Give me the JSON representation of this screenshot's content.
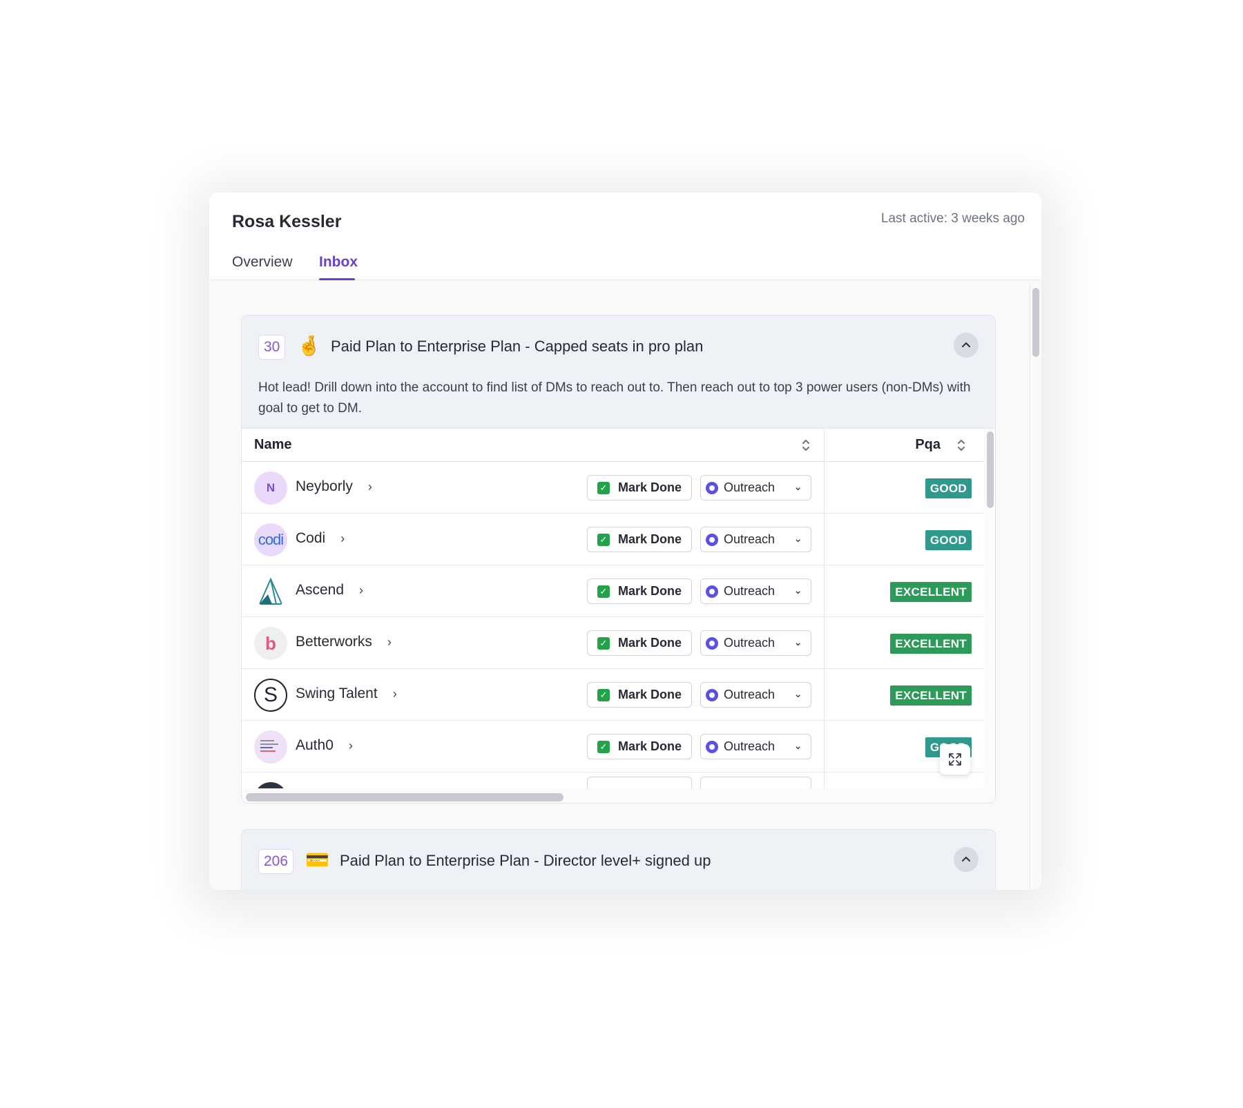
{
  "header": {
    "user_name": "Rosa Kessler",
    "last_active": "Last active: 3 weeks ago",
    "tabs": [
      {
        "label": "Overview",
        "active": false
      },
      {
        "label": "Inbox",
        "active": true
      }
    ]
  },
  "plays": [
    {
      "count": "30",
      "emoji": "🤞",
      "title": "Paid Plan to Enterprise Plan - Capped seats in pro plan",
      "description": "Hot lead! Drill down into the account to find list of DMs to reach out to. Then reach out to top 3 power users (non-DMs) with goal to get to DM.",
      "expanded": true,
      "table": {
        "columns": [
          "Name",
          "Pqa"
        ],
        "mark_done_label": "Mark Done",
        "outreach_label": "Outreach",
        "rows": [
          {
            "name": "Neyborly",
            "avatar": "N",
            "avatar_icon": "neyborly-logo",
            "pqa": "GOOD"
          },
          {
            "name": "Codi",
            "avatar": "codi",
            "avatar_icon": "codi-logo",
            "pqa": "GOOD"
          },
          {
            "name": "Ascend",
            "avatar": "",
            "avatar_icon": "ascend-logo",
            "pqa": "EXCELLENT"
          },
          {
            "name": "Betterworks",
            "avatar": "b",
            "avatar_icon": "betterworks-logo",
            "pqa": "EXCELLENT"
          },
          {
            "name": "Swing Talent",
            "avatar": "S",
            "avatar_icon": "swing-talent-logo",
            "pqa": "EXCELLENT"
          },
          {
            "name": "Auth0",
            "avatar": "",
            "avatar_icon": "auth0-logo",
            "pqa": "GOOD"
          }
        ]
      }
    },
    {
      "count": "206",
      "emoji": "💳",
      "title": "Paid Plan to Enterprise Plan - Director level+ signed up",
      "expanded": true
    }
  ],
  "colors": {
    "accent": "#6d3fc9",
    "good": "#2f9a8c",
    "excellent": "#2e9a5a",
    "check": "#22a34a",
    "outreach": "#5b4fe6"
  }
}
